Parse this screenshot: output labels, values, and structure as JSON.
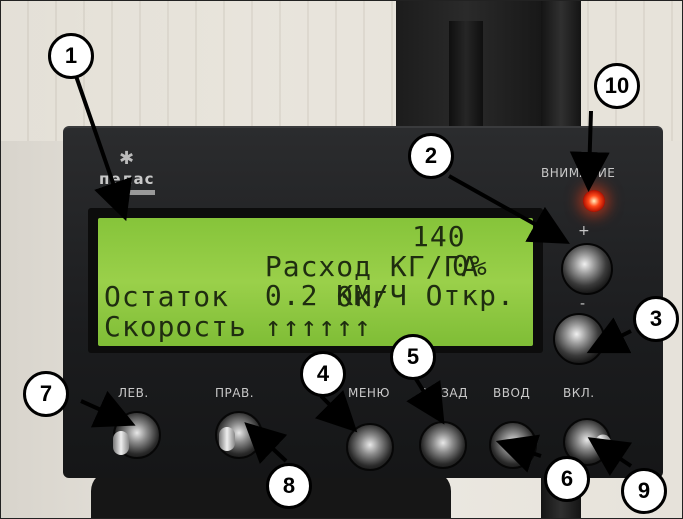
{
  "display": {
    "line1_label": "Расход КГ/ГА",
    "line1_value": "140",
    "line2_label": "0.2 КМ/Ч Откр.",
    "line2_value": "0%",
    "line3": "Остаток      0кг",
    "line4": "Скорость ↑↑↑↑↑↑"
  },
  "panel": {
    "brand": "пелас",
    "warning_label": "ВНИМАНИЕ",
    "plus_label": "+",
    "minus_label": "-",
    "switch_labels": [
      "ЛЕВ.",
      "ПРАВ.",
      "МЕНЮ",
      "НАЗАД",
      "ВВОД",
      "ВКЛ."
    ]
  },
  "callouts": [
    "1",
    "2",
    "3",
    "4",
    "5",
    "6",
    "7",
    "8",
    "9",
    "10"
  ],
  "colors": {
    "lcd": "#8fc83f",
    "led": "#ff3a10",
    "panel": "#1e1f21"
  }
}
